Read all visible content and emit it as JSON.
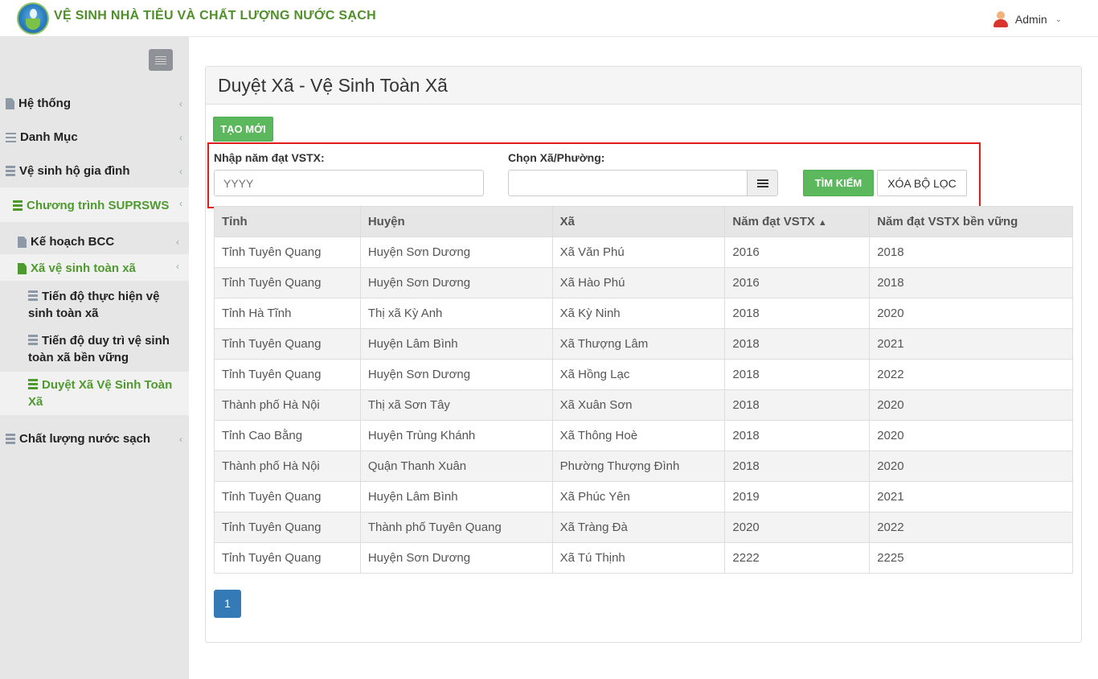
{
  "header": {
    "app_title": "VỆ SINH NHÀ TIÊU VÀ CHẤT LƯỢNG NƯỚC SẠCH",
    "user_name": "Admin",
    "logo_icon": "logo-water-leaf",
    "user_icon": "user-avatar-icon",
    "brand_color": "#4f8f2a"
  },
  "sidebar": {
    "items": [
      {
        "label": "Hệ thống",
        "icon": "file-icon"
      },
      {
        "label": "Danh Mục",
        "icon": "list-icon"
      },
      {
        "label": "Vệ sinh hộ gia đình",
        "icon": "database-icon"
      },
      {
        "label": "Chương trình SUPRSWS",
        "icon": "database-icon",
        "active": true
      },
      {
        "label": "Kế hoạch BCC",
        "icon": "file-icon"
      },
      {
        "label": "Xã vệ sinh toàn xã",
        "icon": "file-icon",
        "active": true
      },
      {
        "label": "Tiến độ thực hiện vệ sinh toàn xã",
        "icon": "database-icon"
      },
      {
        "label": "Tiến độ duy trì vệ sinh toàn xã bền vững",
        "icon": "database-icon"
      },
      {
        "label": "Duyệt Xã Vệ Sinh Toàn Xã",
        "icon": "database-icon",
        "selected": true
      },
      {
        "label": "Chất lượng nước sạch",
        "icon": "database-icon"
      }
    ]
  },
  "main": {
    "title": "Duyệt Xã - Vệ Sinh Toàn Xã",
    "create_label": "TẠO MỚI",
    "filters": {
      "year_label": "Nhập năm đạt VSTX:",
      "year_placeholder": "YYYY",
      "commune_label": "Chọn Xã/Phường:",
      "commune_value": "",
      "search_label": "TÌM KIẾM",
      "clear_label": "XÓA BỘ LỌC"
    },
    "table": {
      "columns": [
        "Tỉnh",
        "Huyện",
        "Xã",
        "Năm đạt VSTX",
        "Năm đạt VSTX bền vững"
      ],
      "sorted_column": "Năm đạt VSTX",
      "rows": [
        [
          "Tỉnh Tuyên Quang",
          "Huyện Sơn Dương",
          "Xã Văn Phú",
          "2016",
          "2018"
        ],
        [
          "Tỉnh Tuyên Quang",
          "Huyện Sơn Dương",
          "Xã Hào Phú",
          "2016",
          "2018"
        ],
        [
          "Tỉnh Hà Tĩnh",
          "Thị xã Kỳ Anh",
          "Xã Kỳ Ninh",
          "2018",
          "2020"
        ],
        [
          "Tỉnh Tuyên Quang",
          "Huyện Lâm Bình",
          "Xã Thượng Lâm",
          "2018",
          "2021"
        ],
        [
          "Tỉnh Tuyên Quang",
          "Huyện Sơn Dương",
          "Xã Hồng Lạc",
          "2018",
          "2022"
        ],
        [
          "Thành phố Hà Nội",
          "Thị xã Sơn Tây",
          "Xã Xuân Sơn",
          "2018",
          "2020"
        ],
        [
          "Tỉnh Cao Bằng",
          "Huyện Trùng Khánh",
          "Xã Thông Hoè",
          "2018",
          "2020"
        ],
        [
          "Thành phố Hà Nội",
          "Quận Thanh Xuân",
          "Phường Thượng Đình",
          "2018",
          "2020"
        ],
        [
          "Tỉnh Tuyên Quang",
          "Huyện Lâm Bình",
          "Xã Phúc Yên",
          "2019",
          "2021"
        ],
        [
          "Tỉnh Tuyên Quang",
          "Thành phố Tuyên Quang",
          "Xã Tràng Đà",
          "2020",
          "2022"
        ],
        [
          "Tỉnh Tuyên Quang",
          "Huyện Sơn Dương",
          "Xã Tú Thịnh",
          "2222",
          "2225"
        ]
      ]
    },
    "pagination": {
      "current_page": "1"
    }
  }
}
